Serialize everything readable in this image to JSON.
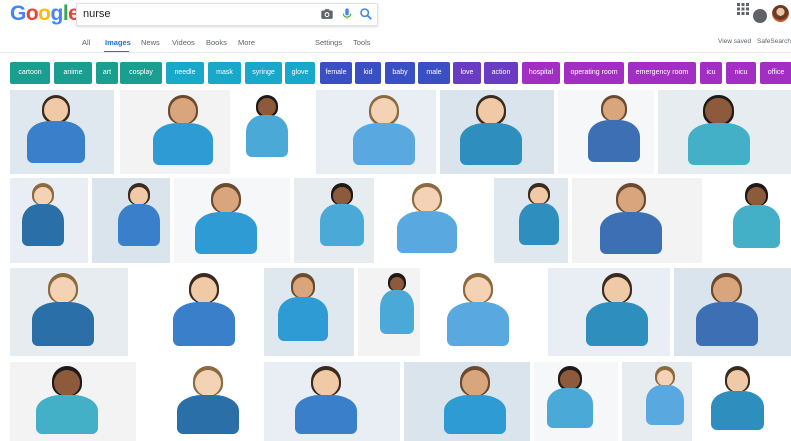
{
  "logo": {
    "letters": [
      "G",
      "o",
      "o",
      "g",
      "l",
      "e"
    ],
    "colors": [
      "#4285f4",
      "#ea4335",
      "#fbbc05",
      "#4285f4",
      "#34a853",
      "#ea4335"
    ]
  },
  "search": {
    "value": "nurse"
  },
  "icons": {
    "camera": "camera-icon",
    "mic": "microphone-icon",
    "search": "search-icon",
    "apps": "apps-grid-icon",
    "notifications": "notifications-icon"
  },
  "nav": {
    "tabs": [
      {
        "label": "All",
        "active": false
      },
      {
        "label": "Images",
        "active": true
      },
      {
        "label": "News",
        "active": false
      },
      {
        "label": "Videos",
        "active": false
      },
      {
        "label": "Books",
        "active": false
      },
      {
        "label": "More",
        "active": false
      },
      {
        "label": "Settings",
        "active": false
      },
      {
        "label": "Tools",
        "active": false
      }
    ],
    "view_saved": "View saved",
    "safesearch": "SafeSearch"
  },
  "chips": [
    {
      "label": "cartoon",
      "color": "#1a9e8f"
    },
    {
      "label": "anime",
      "color": "#1a9e8f"
    },
    {
      "label": "art",
      "color": "#1a9e8f"
    },
    {
      "label": "cosplay",
      "color": "#1a9e8f"
    },
    {
      "label": "needle",
      "color": "#18a8c9"
    },
    {
      "label": "mask",
      "color": "#18a8c9"
    },
    {
      "label": "syringe",
      "color": "#18a8c9"
    },
    {
      "label": "glove",
      "color": "#18a8c9"
    },
    {
      "label": "female",
      "color": "#3b4fc4"
    },
    {
      "label": "kid",
      "color": "#3b4fc4"
    },
    {
      "label": "baby",
      "color": "#3b4fc4"
    },
    {
      "label": "male",
      "color": "#3b4fc4"
    },
    {
      "label": "love",
      "color": "#6a3cc4"
    },
    {
      "label": "action",
      "color": "#6a3cc4"
    },
    {
      "label": "hospital",
      "color": "#a22ec4"
    },
    {
      "label": "operating room",
      "color": "#a22ec4"
    },
    {
      "label": "emergency room",
      "color": "#a22ec4"
    },
    {
      "label": "icu",
      "color": "#a22ec4"
    },
    {
      "label": "nicu",
      "color": "#a22ec4"
    },
    {
      "label": "office",
      "color": "#a22ec4"
    },
    {
      "label": "",
      "color": "#d1206f"
    }
  ],
  "results": {
    "item": "image-result"
  }
}
